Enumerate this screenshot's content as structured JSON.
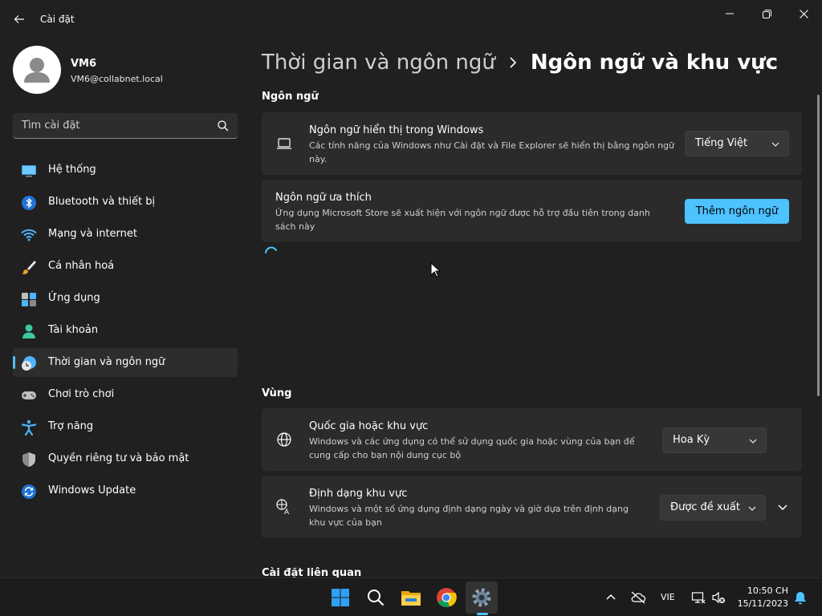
{
  "window": {
    "title": "Cài đặt"
  },
  "user": {
    "name": "VM6",
    "email": "VM6@collabnet.local"
  },
  "search": {
    "placeholder": "Tìm cài đặt"
  },
  "sidebar": {
    "items": [
      {
        "label": "Hệ thống",
        "icon": "monitor-icon"
      },
      {
        "label": "Bluetooth và thiết bị",
        "icon": "bluetooth-icon"
      },
      {
        "label": "Mạng và internet",
        "icon": "wifi-icon"
      },
      {
        "label": "Cá nhân hoá",
        "icon": "brush-icon"
      },
      {
        "label": "Ứng dụng",
        "icon": "apps-icon"
      },
      {
        "label": "Tài khoản",
        "icon": "account-icon"
      },
      {
        "label": "Thời gian và ngôn ngữ",
        "icon": "time-language-icon",
        "active": true
      },
      {
        "label": "Chơi trò chơi",
        "icon": "gamepad-icon"
      },
      {
        "label": "Trợ năng",
        "icon": "accessibility-icon"
      },
      {
        "label": "Quyền riêng tư và bảo mật",
        "icon": "shield-icon"
      },
      {
        "label": "Windows Update",
        "icon": "update-icon"
      }
    ]
  },
  "breadcrumb": {
    "parent": "Thời gian và ngôn ngữ",
    "current": "Ngôn ngữ và khu vực"
  },
  "language_section": {
    "title": "Ngôn ngữ",
    "display_language": {
      "title": "Ngôn ngữ hiển thị trong Windows",
      "description": "Các tính năng của Windows như Cài đặt và File Explorer sẽ hiển thị bằng ngôn ngữ này.",
      "value": "Tiếng Việt"
    },
    "preferred": {
      "title": "Ngôn ngữ ưa thích",
      "description": "Ứng dụng Microsoft Store sẽ xuất hiện với ngôn ngữ được hỗ trợ đầu tiên trong danh sách này",
      "button": "Thêm ngôn ngữ"
    }
  },
  "region_section": {
    "title": "Vùng",
    "country": {
      "title": "Quốc gia hoặc khu vực",
      "description": "Windows và các ứng dụng có thể sử dụng quốc gia hoặc vùng của bạn để cung cấp cho bạn nội dung cục bộ",
      "value": "Hoa Kỳ"
    },
    "format": {
      "title": "Định dạng khu vực",
      "description": "Windows và một số ứng dụng định dạng ngày và giờ dựa trên định dạng khu vực của bạn",
      "value": "Được đề xuất"
    }
  },
  "related_section": {
    "title": "Cài đặt liên quan"
  },
  "taskbar": {
    "apps": [
      "start-icon",
      "search-icon",
      "file-explorer-icon",
      "chrome-icon",
      "settings-icon"
    ],
    "language": "VIE",
    "time": "10:50 CH",
    "date": "15/11/2023"
  },
  "colors": {
    "accent": "#4cc2ff",
    "background": "#202020",
    "card": "#2b2b2b"
  }
}
